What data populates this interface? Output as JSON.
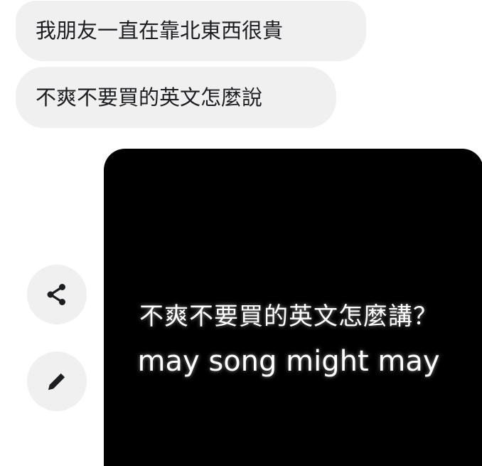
{
  "messages": [
    {
      "text": "我朋友一直在靠北東西很貴"
    },
    {
      "text": "不爽不要買的英文怎麼說"
    }
  ],
  "actions": {
    "share_icon": "share-icon",
    "edit_icon": "pencil-icon"
  },
  "media": {
    "caption_line1": "不爽不要買的英文怎麼講？",
    "caption_line2": "may song might may"
  },
  "colors": {
    "bubble_bg": "#f0f0f1",
    "media_bg": "#000000",
    "media_text": "#ffffff",
    "icon": "#1c1e21"
  }
}
